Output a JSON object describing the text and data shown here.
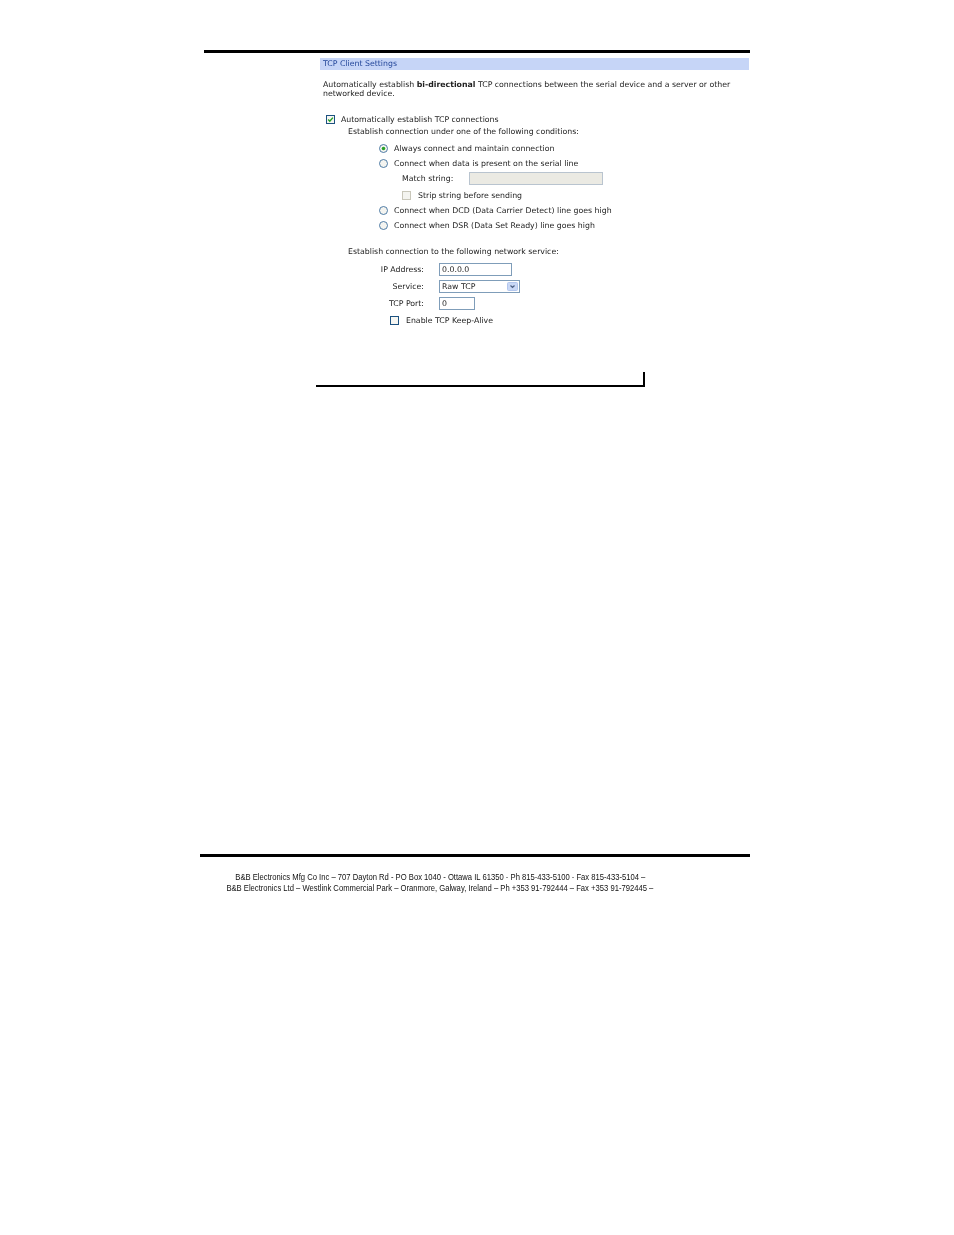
{
  "panel": {
    "title": "TCP Client Settings",
    "description": "Automatically establish **bi-directional** TCP connections between the serial device and a server or other networked device.",
    "auto_connect": {
      "label": "Automatically establish TCP connections",
      "checked": true
    },
    "conditions_heading": "Establish connection under one of the following conditions:",
    "conditions": [
      {
        "label": "Always connect and maintain connection",
        "selected": true
      },
      {
        "label": "Connect when data is present on the serial line",
        "selected": false,
        "match_string": {
          "label": "Match string:",
          "disabled": true
        },
        "strip_string": {
          "label": "Strip string before sending",
          "checked": false,
          "disabled": true
        }
      },
      {
        "label": "Connect when DCD (Data Carrier Detect) line goes high",
        "selected": false
      },
      {
        "label": "Connect when DSR (Data Set Ready) line goes high",
        "selected": false
      }
    ],
    "service_heading": "Establish connection to the following network service:",
    "service_fields": [
      {
        "kind": "text",
        "label": "IP Address:",
        "value": "0.0.0.0"
      },
      {
        "kind": "select",
        "label": "Service:",
        "value": "Raw TCP"
      },
      {
        "kind": "text",
        "label": "TCP Port:",
        "value": "0"
      }
    ],
    "keep_alive": {
      "label": "Enable TCP Keep-Alive",
      "checked": false
    }
  },
  "footer": {
    "lines": [
      "B&B Electronics Mfg Co Inc – 707 Dayton Rd - PO Box 1040 - Ottawa IL 61350 - Ph 815-433-5100 - Fax 815-433-5104 –",
      "B&B Electronics Ltd – Westlink Commercial Park – Oranmore, Galway, Ireland – Ph +353 91-792444 – Fax +353 91-792445 –"
    ]
  }
}
